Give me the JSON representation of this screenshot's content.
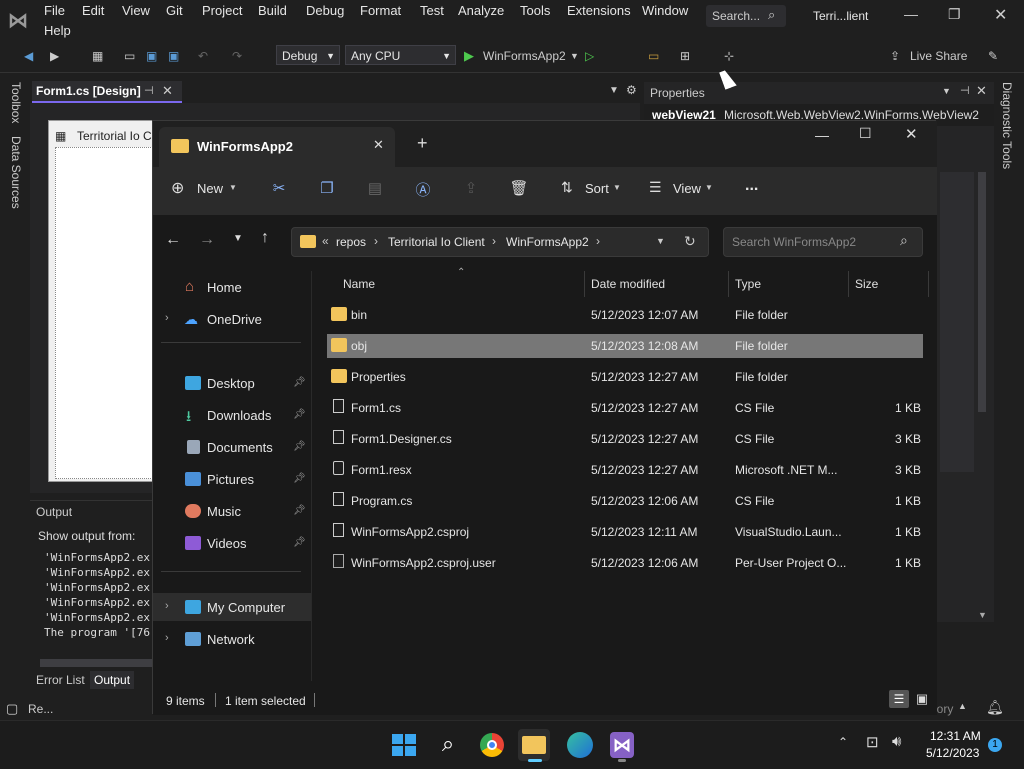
{
  "vs": {
    "menu": [
      "File",
      "Edit",
      "View",
      "Git",
      "Project",
      "Build",
      "Debug",
      "Format",
      "Test",
      "Analyze",
      "Tools",
      "Extensions",
      "Window",
      "Help"
    ],
    "search_placeholder": "Search...",
    "window_title": "Terri...lient",
    "config": "Debug",
    "platform": "Any CPU",
    "start_target": "WinFormsApp2",
    "live_share": "Live Share",
    "left_tabs": [
      "Toolbox",
      "Data Sources"
    ],
    "right_tab": "Diagnostic Tools",
    "designer_tab": "Form1.cs [Design]",
    "form_title": "Territorial Io Cl",
    "properties_title": "Properties",
    "properties_object_name": "webView21",
    "properties_object_type": "Microsoft.Web.WebView2.WinForms.WebView2",
    "output_title": "Output",
    "output_show_from": "Show output from:",
    "output_lines": [
      "'WinFormsApp2.ex",
      "'WinFormsApp2.ex",
      "'WinFormsApp2.ex",
      "'WinFormsApp2.ex",
      "'WinFormsApp2.ex",
      "The program '[76"
    ],
    "bottom_tabs": [
      "Error List",
      "Output"
    ],
    "status_left": "Re...",
    "status_right_fragment": "ository"
  },
  "explorer": {
    "tab_title": "WinFormsApp2",
    "commands": {
      "new": "New",
      "sort": "Sort",
      "view": "View",
      "more": "..."
    },
    "breadcrumb": [
      "repos",
      "Territorial Io Client",
      "WinFormsApp2"
    ],
    "search_placeholder": "Search WinFormsApp2",
    "nav": {
      "home": "Home",
      "onedrive": "OneDrive",
      "desktop": "Desktop",
      "downloads": "Downloads",
      "documents": "Documents",
      "pictures": "Pictures",
      "music": "Music",
      "videos": "Videos",
      "mycomputer": "My Computer",
      "network": "Network"
    },
    "columns": {
      "name": "Name",
      "date": "Date modified",
      "type": "Type",
      "size": "Size"
    },
    "files": [
      {
        "name": "bin",
        "date": "5/12/2023 12:07 AM",
        "type": "File folder",
        "size": ""
      },
      {
        "name": "obj",
        "date": "5/12/2023 12:08 AM",
        "type": "File folder",
        "size": ""
      },
      {
        "name": "Properties",
        "date": "5/12/2023 12:27 AM",
        "type": "File folder",
        "size": ""
      },
      {
        "name": "Form1.cs",
        "date": "5/12/2023 12:27 AM",
        "type": "CS File",
        "size": "1 KB"
      },
      {
        "name": "Form1.Designer.cs",
        "date": "5/12/2023 12:27 AM",
        "type": "CS File",
        "size": "3 KB"
      },
      {
        "name": "Form1.resx",
        "date": "5/12/2023 12:27 AM",
        "type": "Microsoft .NET M...",
        "size": "3 KB"
      },
      {
        "name": "Program.cs",
        "date": "5/12/2023 12:06 AM",
        "type": "CS File",
        "size": "1 KB"
      },
      {
        "name": "WinFormsApp2.csproj",
        "date": "5/12/2023 12:11 AM",
        "type": "VisualStudio.Laun...",
        "size": "1 KB"
      },
      {
        "name": "WinFormsApp2.csproj.user",
        "date": "5/12/2023 12:06 AM",
        "type": "Per-User Project O...",
        "size": "1 KB"
      }
    ],
    "status_items": "9 items",
    "status_selected": "1 item selected"
  },
  "taskbar": {
    "time": "12:31 AM",
    "date": "5/12/2023",
    "notification_count": "1"
  },
  "colors": {
    "accent": "#7b68ee",
    "folder": "#f2c55c",
    "selection": "#777777"
  }
}
